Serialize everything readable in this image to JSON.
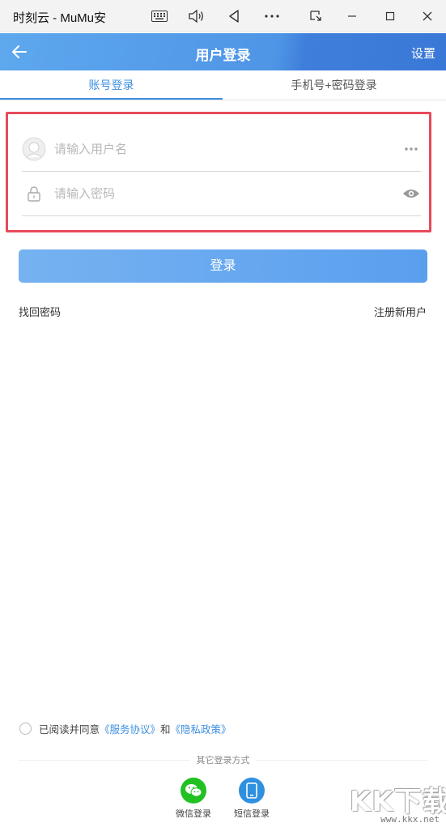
{
  "window": {
    "title": "时刻云 - MuMu安",
    "buttons": [
      "keyboard-icon",
      "volume-icon",
      "back-triangle-icon",
      "more-icon",
      "screen-rotate-icon",
      "minimize-icon",
      "maximize-icon",
      "close-icon"
    ]
  },
  "header": {
    "title": "用户登录",
    "settings_label": "设置",
    "gradient_colors": [
      "#5ea8ee",
      "#3a78d7"
    ]
  },
  "tabs": [
    {
      "label": "账号登录",
      "active": true
    },
    {
      "label": "手机号+密码登录",
      "active": false
    }
  ],
  "form": {
    "username_placeholder": "请输入用户名",
    "username_value": "",
    "password_placeholder": "请输入密码",
    "password_value": "",
    "highlight_color": "#e84a5a"
  },
  "login_button": {
    "label": "登录",
    "color": "#5a9fee"
  },
  "links": {
    "forgot_password": "找回密码",
    "register": "注册新用户"
  },
  "agreement": {
    "prefix": "已阅读并同意",
    "service_terms": "《服务协议》",
    "and": "和",
    "privacy_policy": "《隐私政策》",
    "checked": false
  },
  "other_login": {
    "title": "其它登录方式",
    "methods": [
      {
        "label": "微信登录",
        "icon": "wechat-icon",
        "color": "#22c122"
      },
      {
        "label": "短信登录",
        "icon": "phone-icon",
        "color": "#2f90e0"
      }
    ]
  },
  "watermark": {
    "text": "KK下载",
    "url": "www.kkx.net"
  }
}
